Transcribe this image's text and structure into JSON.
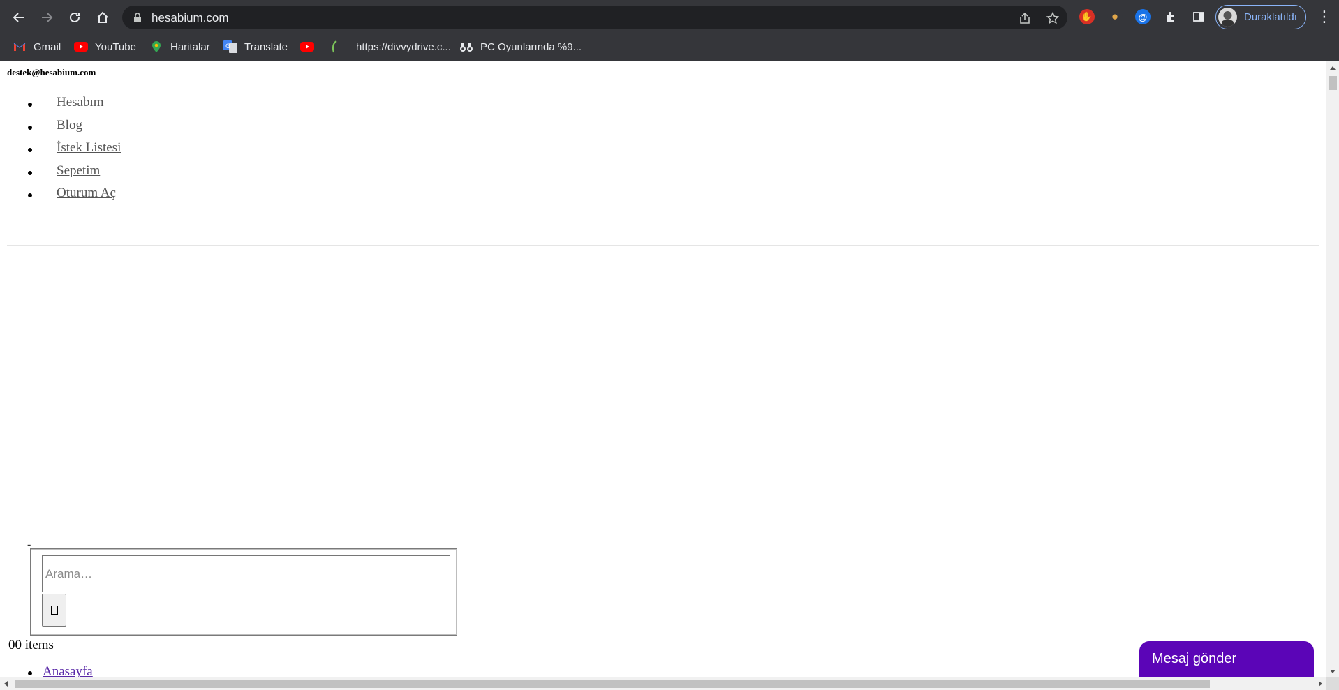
{
  "browser": {
    "url": "hesabium.com",
    "profile_label": "Duraklatıldı",
    "bookmarks": [
      {
        "label": "Gmail",
        "icon": "gmail-icon"
      },
      {
        "label": "YouTube",
        "icon": "youtube-icon"
      },
      {
        "label": "Haritalar",
        "icon": "maps-icon"
      },
      {
        "label": "Translate",
        "icon": "translate-icon"
      },
      {
        "label": "",
        "icon": "youtube-icon"
      },
      {
        "label": "https://divvydrive.c...",
        "icon": "divvydrive-icon"
      },
      {
        "label": "PC Oyunlarında %9...",
        "icon": "binoculars-icon"
      }
    ],
    "extensions": [
      "adblock-icon",
      "cookie-icon",
      "at-sign-icon",
      "puzzle-icon",
      "side-panel-icon"
    ],
    "colors": {
      "chrome": "#35363a",
      "omnibox": "#202124",
      "accent": "#8ab4f8"
    }
  },
  "page": {
    "email": "destek@hesabium.com",
    "menu": [
      "Hesabım",
      "Blog",
      "İstek Listesi",
      "Sepetim",
      "Oturum Aç"
    ],
    "dash": "-",
    "search": {
      "placeholder": "Arama…",
      "button_glyph": "search-icon"
    },
    "cart_items": "00 items",
    "nav_first": "Anasayfa",
    "chat_button": "Mesaj gönder",
    "colors": {
      "chat": "#5b05b7",
      "link": "#555555",
      "visited_link": "#5a2aa8"
    }
  }
}
